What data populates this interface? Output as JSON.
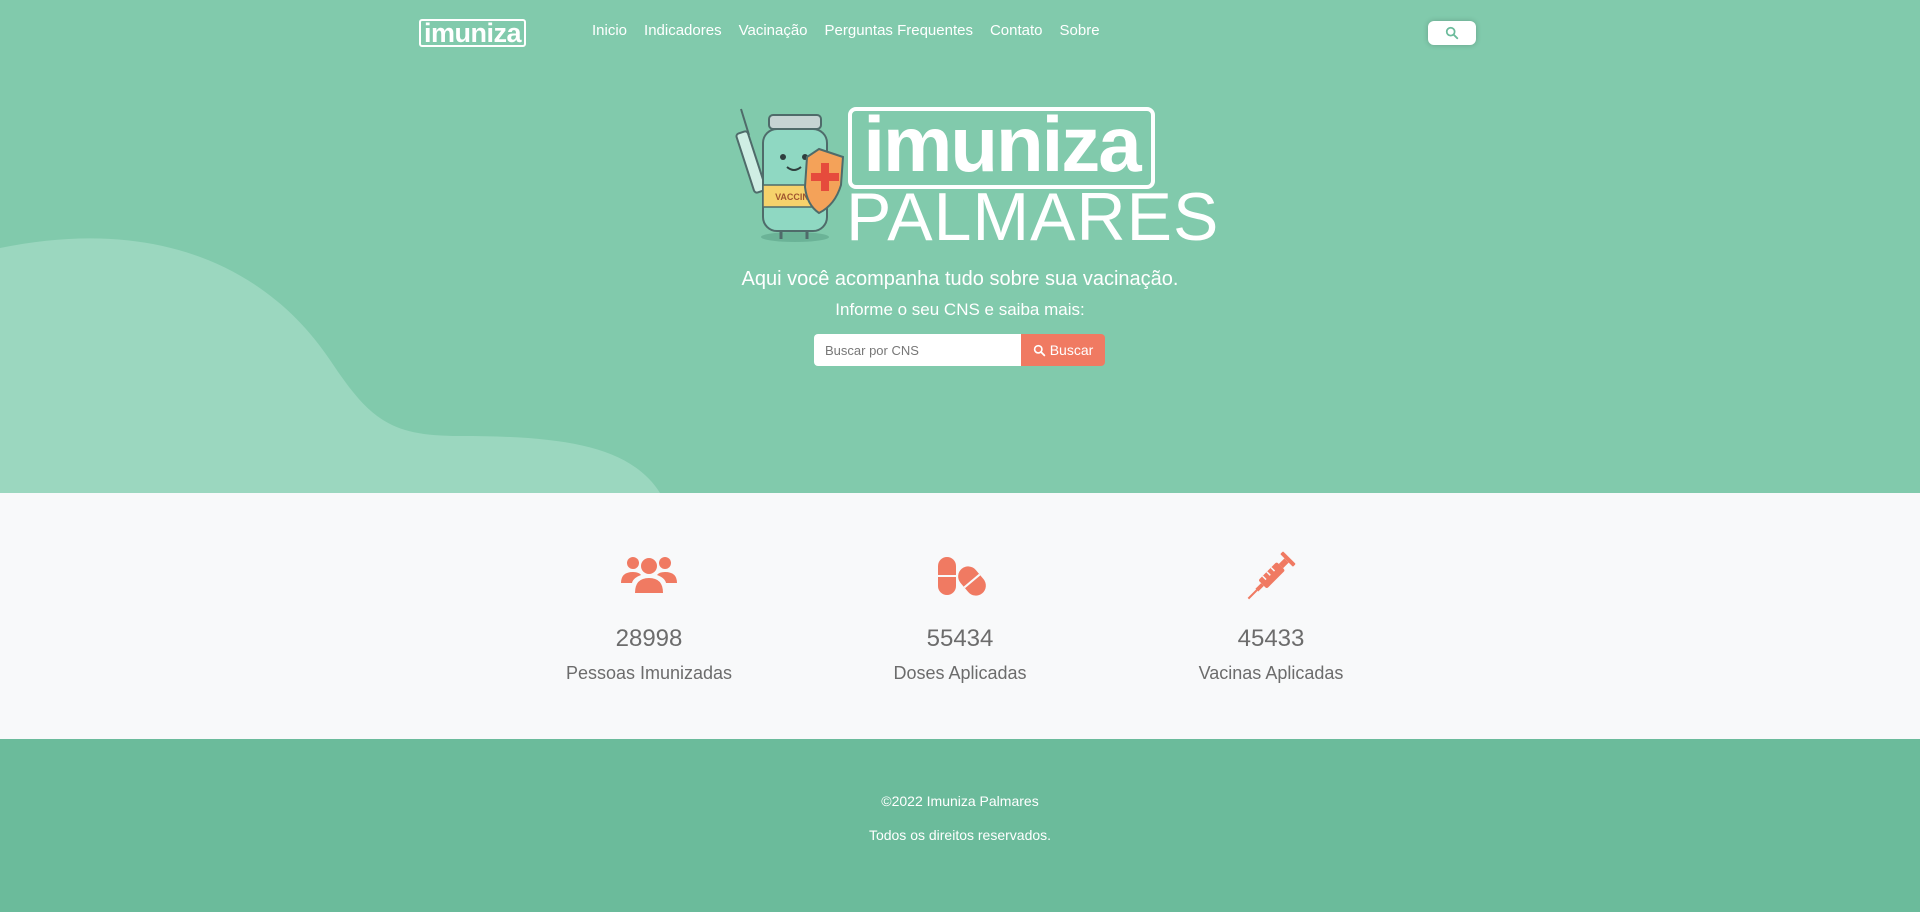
{
  "nav": {
    "logo_text": "imuniza",
    "links": [
      "Inicio",
      "Indicadores",
      "Vacinação",
      "Perguntas Frequentes",
      "Contato",
      "Sobre"
    ],
    "search_icon": "search-icon"
  },
  "hero": {
    "brand_name": "imuniza",
    "brand_city": "PALMARES",
    "mascot_text": "VACCINE",
    "tagline": "Aqui você acompanha tudo sobre sua vacinação.",
    "subtagline": "Informe o seu CNS e saiba mais:",
    "search_placeholder": "Buscar por CNS",
    "search_button": "Buscar"
  },
  "stats": [
    {
      "icon": "users-icon",
      "value": "28998",
      "label": "Pessoas Imunizadas"
    },
    {
      "icon": "pills-icon",
      "value": "55434",
      "label": "Doses Aplicadas"
    },
    {
      "icon": "syringe-icon",
      "value": "45433",
      "label": "Vacinas Aplicadas"
    }
  ],
  "footer": {
    "copyright": "©2022 Imuniza Palmares",
    "rights": "Todos os direitos reservados."
  },
  "colors": {
    "hero_bg": "#81caac",
    "accent": "#f07a62",
    "footer_bg": "#6bbb9b",
    "stats_bg": "#f8f9fa"
  }
}
